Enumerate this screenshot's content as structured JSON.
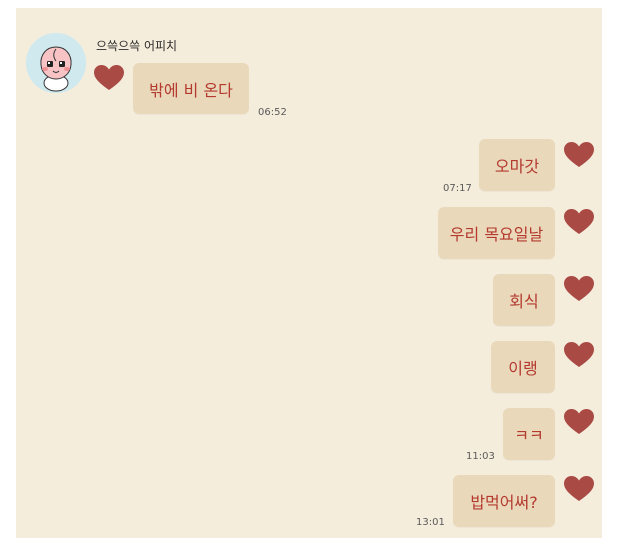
{
  "chat": {
    "background": "#f5eddc",
    "bubble_color": "#ead8ba",
    "text_color": "#b4392f",
    "heart_color": "#a94a45"
  },
  "sender": {
    "name": "으쓱으쓱 어피치",
    "avatar_icon": "apeach-character-icon"
  },
  "messages": [
    {
      "side": "left",
      "text": "밖에 비 온다",
      "time": "06:52"
    },
    {
      "side": "right",
      "text": "오마갓",
      "time": "07:17"
    },
    {
      "side": "right",
      "text": "우리 목요일날",
      "time": ""
    },
    {
      "side": "right",
      "text": "회식",
      "time": ""
    },
    {
      "side": "right",
      "text": "이랭",
      "time": ""
    },
    {
      "side": "right",
      "text": "ㅋㅋ",
      "time": "11:03"
    },
    {
      "side": "right",
      "text": "밥먹어써?",
      "time": "13:01"
    }
  ]
}
